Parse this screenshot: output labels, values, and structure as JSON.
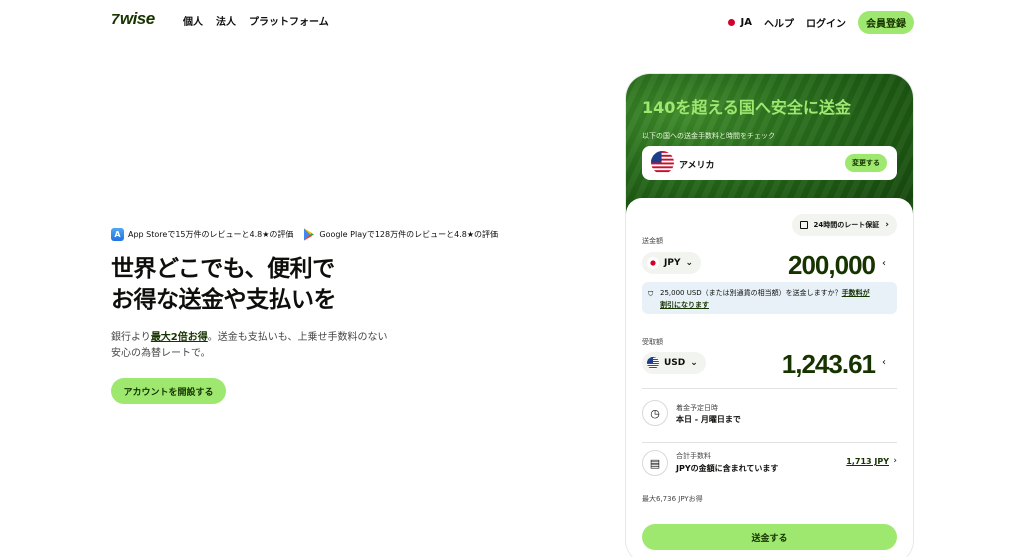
{
  "header": {
    "logo_text": "wise",
    "logo_mark": "7",
    "nav_left": [
      "個人",
      "法人",
      "プラットフォーム"
    ],
    "lang": "JA",
    "help": "ヘルプ",
    "login": "ログイン",
    "signup": "会員登録"
  },
  "hero": {
    "rating_appstore": "App Storeで15万件のレビューと4.8★の評価",
    "rating_gplay": "Google Playで128万件のレビューと4.8★の評価",
    "headline_line1": "世界どこでも、便利で",
    "headline_line2": "お得な送金や支払いを",
    "sub_pre": "銀行より",
    "sub_highlight": "最大2倍お得",
    "sub_post": "。送金も支払いも、上乗せ手数料のない",
    "sub_line2": "安心の為替レートで。",
    "cta": "アカウントを開設する"
  },
  "calculator": {
    "title": "140を超える国へ安全に送金",
    "subtitle": "以下の国への送金手数料と時間をチェック",
    "country": "アメリカ",
    "change_button": "変更する",
    "rate_guarantee": "24時間のレート保証",
    "send_label": "送金額",
    "send_currency": "JPY",
    "send_amount": "200,000",
    "info_text": "25,000 USD（または別通貨の相当額）を送金しますか？",
    "info_link_1": "手数料が",
    "info_link_2": "割引になります",
    "receive_label": "受取額",
    "receive_currency": "USD",
    "receive_amount": "1,243.61",
    "arrival_label": "着金予定日時",
    "arrival_value": "本日 - 月曜日まで",
    "fee_label": "合計手数料",
    "fee_value": "JPYの金額に含まれています",
    "fee_amount": "1,713 JPY",
    "savings": "最大6,736 JPYお得",
    "send_button": "送金する"
  },
  "colors": {
    "brand_green": "#9fe870",
    "forest_green": "#163300"
  },
  "icons": {
    "lock": "lock-icon",
    "clock": "clock-icon",
    "receipt": "receipt-icon",
    "info": "info-icon"
  }
}
